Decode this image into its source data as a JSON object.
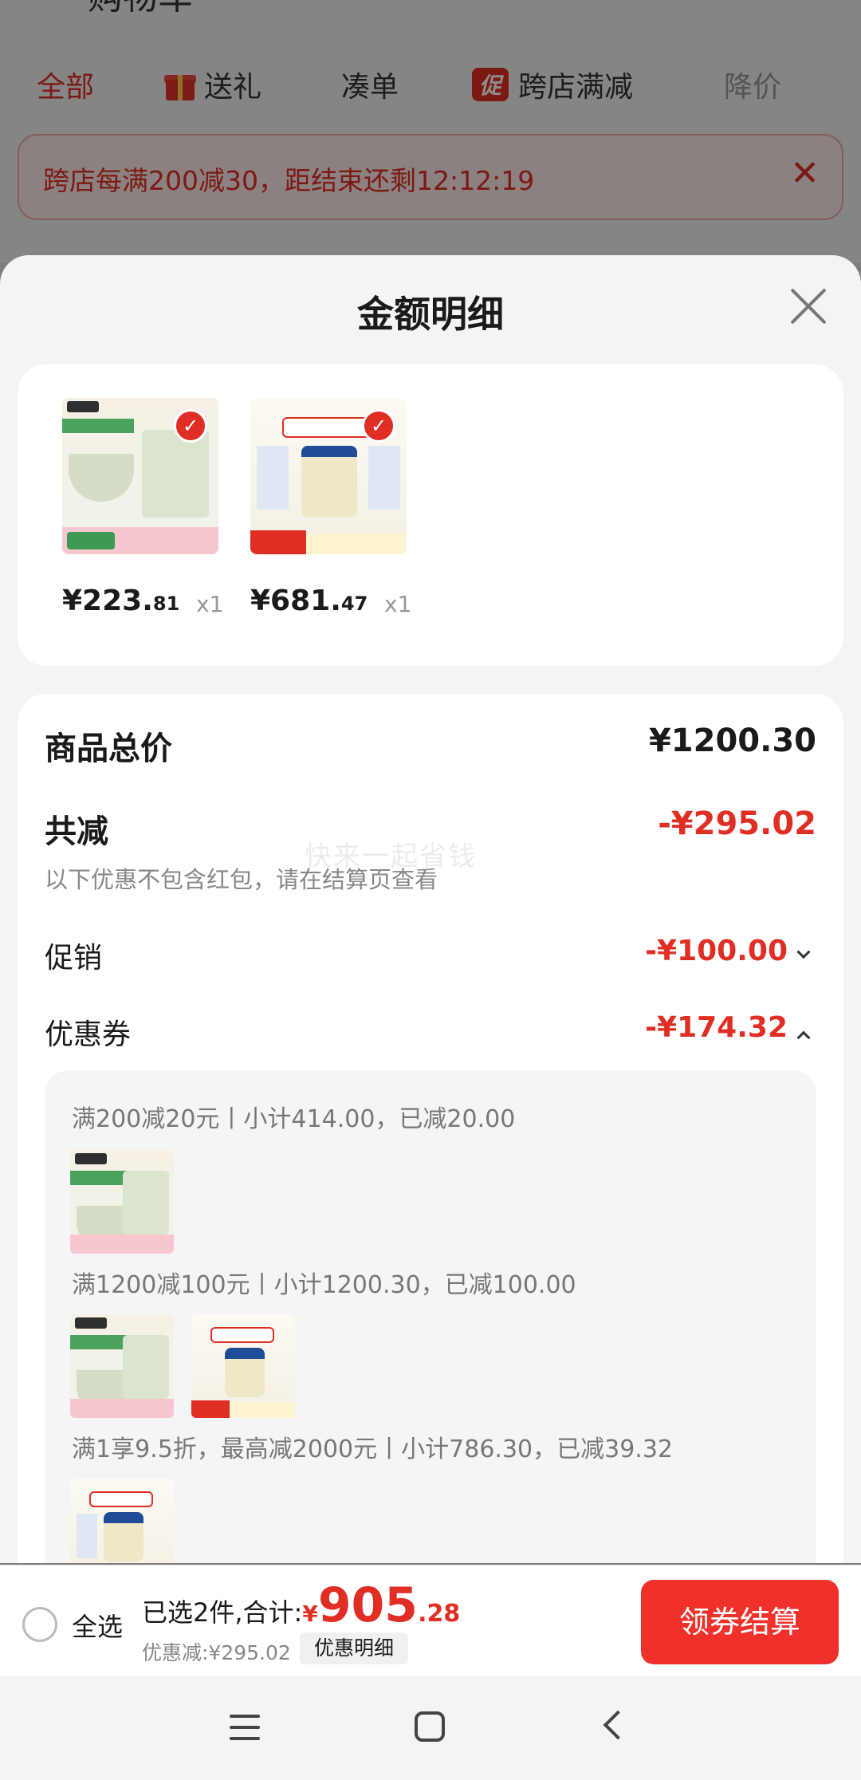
{
  "background_page": {
    "title_partial": "购物车",
    "tabs": [
      {
        "label": "全部",
        "state": "active",
        "icon": null
      },
      {
        "label": "送礼",
        "state": "normal",
        "icon": "gift-icon"
      },
      {
        "label": "凑单",
        "state": "normal",
        "icon": null
      },
      {
        "label": "跨店满减",
        "state": "normal",
        "icon": "promo-badge-icon",
        "icon_text": "促"
      },
      {
        "label": "降价",
        "state": "muted",
        "icon": null
      }
    ],
    "banner_text": "跨店每满200减30，距结束还剩12:12:19"
  },
  "sheet": {
    "title": "金额明细",
    "products": [
      {
        "price_int": "¥223.",
        "price_dec": "81",
        "qty": "x1"
      },
      {
        "price_int": "¥681.",
        "price_dec": "47",
        "qty": "x1"
      }
    ],
    "summary": {
      "total_label": "商品总价",
      "total_value": "¥1200.30",
      "reduce_label": "共减",
      "reduce_value": "-¥295.02",
      "reduce_note": "以下优惠不包含红包，请在结算页查看",
      "watermark": "快来一起省钱",
      "promo_label": "促销",
      "promo_value": "-¥100.00",
      "coupon_label": "优惠券",
      "coupon_value": "-¥174.32"
    },
    "coupons": [
      {
        "text": "满200减20元丨小计414.00，已减20.00"
      },
      {
        "text": "满1200减100元丨小计1200.30，已减100.00"
      },
      {
        "text": "满1享9.5折，最高减2000元丨小计786.30，已减39.32"
      }
    ]
  },
  "bottom_bar": {
    "select_all": "全选",
    "selected_prefix": "已选2件,合计:",
    "currency": "¥",
    "total_int": "905",
    "total_dec": ".28",
    "discount_text": "优惠减:¥295.02",
    "detail_button": "优惠明细",
    "checkout_button": "领券结算"
  },
  "colors": {
    "accent_red": "#e02e24",
    "checkout_red": "#f0302a"
  }
}
